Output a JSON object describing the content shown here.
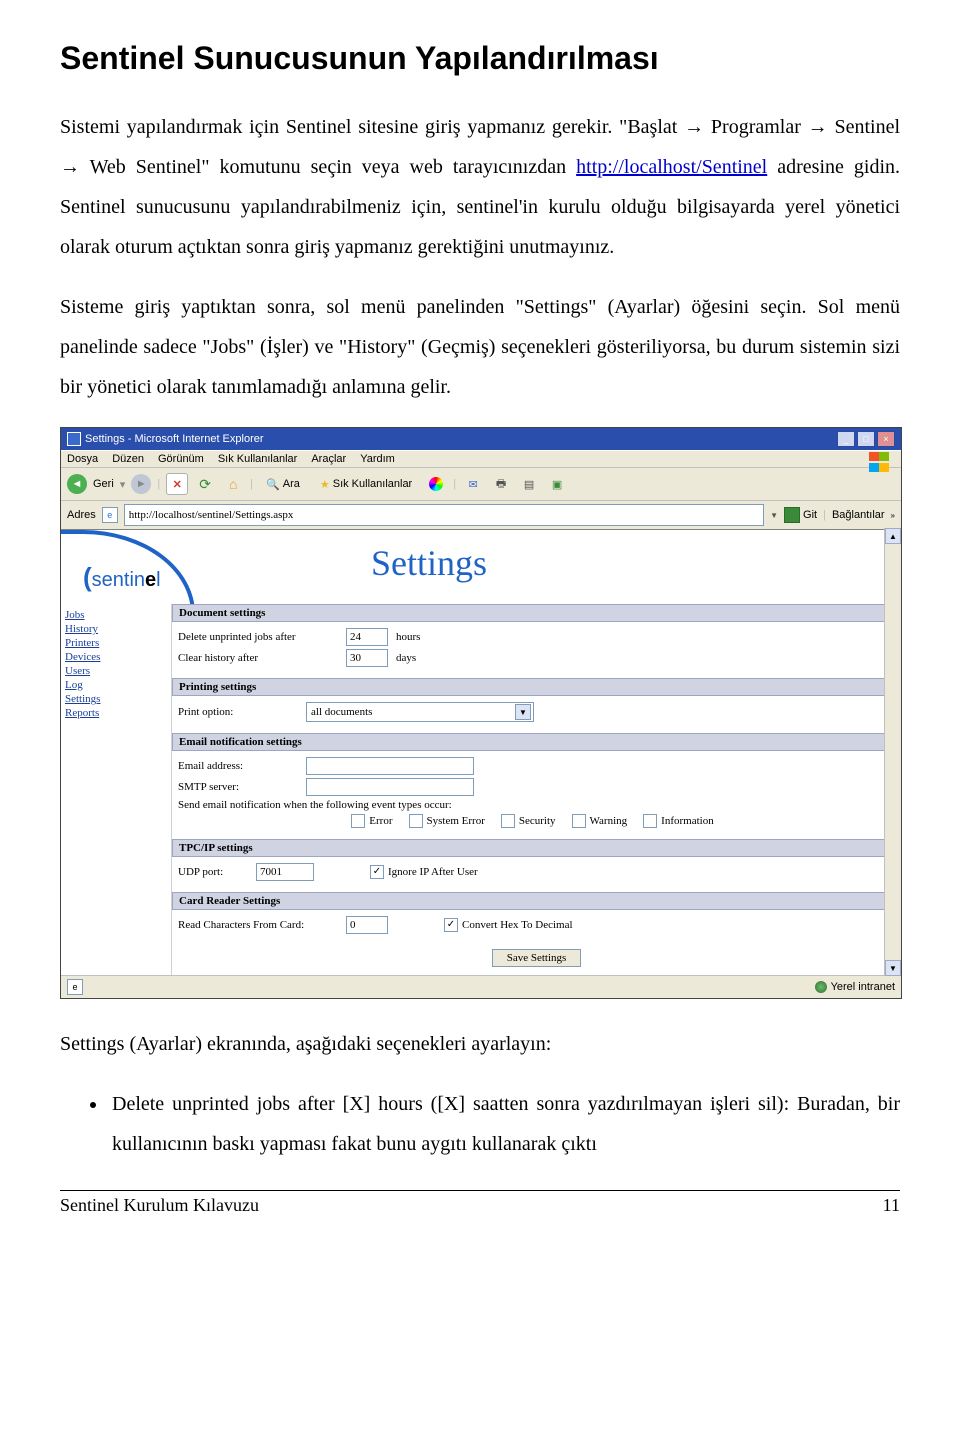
{
  "heading": "Sentinel Sunucusunun Yapılandırılması",
  "para1_a": "Sistemi yapılandırmak için Sentinel sitesine giriş yapmanız gerekir. \"Başlat ",
  "arrow": "→",
  "para1_b": " Programlar ",
  "para1_c": " Sentinel ",
  "para1_d": " Web Sentinel\" komutunu seçin veya web tarayıcınızdan ",
  "link_text": "http://localhost/Sentinel",
  "para1_e": " adresine gidin. Sentinel sunucusunu yapılandırabilmeniz için, sentinel'in kurulu olduğu bilgisayarda yerel yönetici olarak oturum açtıktan sonra giriş yapmanız gerektiğini unutmayınız.",
  "para2": "Sisteme giriş yaptıktan sonra, sol menü panelinden \"Settings\" (Ayarlar) öğesini seçin. Sol menü panelinde sadece \"Jobs\" (İşler) ve \"History\" (Geçmiş) seçenekleri gösteriliyorsa, bu durum sistemin sizi bir yönetici olarak tanımlamadığı anlamına gelir.",
  "ie": {
    "title": "Settings - Microsoft Internet Explorer",
    "menu": [
      "Dosya",
      "Düzen",
      "Görünüm",
      "Sık Kullanılanlar",
      "Araçlar",
      "Yardım"
    ],
    "toolbar": {
      "back": "Geri",
      "search": "Ara",
      "fav": "Sık Kullanılanlar"
    },
    "addr_label": "Adres",
    "addr_value": "http://localhost/sentinel/Settings.aspx",
    "go": "Git",
    "links": "Bağlantılar",
    "logo_a": "sentin",
    "logo_b": "e",
    "logo_c": "l",
    "page_title": "Settings",
    "nav": [
      "Jobs",
      "History",
      "Printers",
      "Devices",
      "Users",
      "Log",
      "Settings",
      "Reports"
    ],
    "sections": {
      "doc": {
        "title": "Document settings",
        "r1_label": "Delete unprinted jobs after",
        "r1_val": "24",
        "r1_unit": "hours",
        "r2_label": "Clear history after",
        "r2_val": "30",
        "r2_unit": "days"
      },
      "print": {
        "title": "Printing settings",
        "label": "Print option:",
        "value": "all documents"
      },
      "email": {
        "title": "Email notification settings",
        "addr": "Email address:",
        "smtp": "SMTP server:",
        "note": "Send email notification when the following event types occur:",
        "opts": [
          "Error",
          "System Error",
          "Security",
          "Warning",
          "Information"
        ]
      },
      "tcp": {
        "title": "TPC/IP settings",
        "udp_label": "UDP port:",
        "udp_val": "7001",
        "chk": "Ignore IP After User"
      },
      "card": {
        "title": "Card Reader Settings",
        "label": "Read Characters From Card:",
        "val": "0",
        "chk": "Convert Hex To Decimal"
      },
      "save": "Save Settings"
    },
    "status_right": "Yerel intranet"
  },
  "after_shot": "Settings (Ayarlar) ekranında, aşağıdaki seçenekleri ayarlayın:",
  "bullet1": "Delete unprinted jobs after [X] hours ([X] saatten sonra yazdırılmayan işleri sil): Buradan, bir kullanıcının baskı yapması fakat bunu aygıtı kullanarak çıktı",
  "footer_left": "Sentinel Kurulum Kılavuzu",
  "footer_right": "11"
}
